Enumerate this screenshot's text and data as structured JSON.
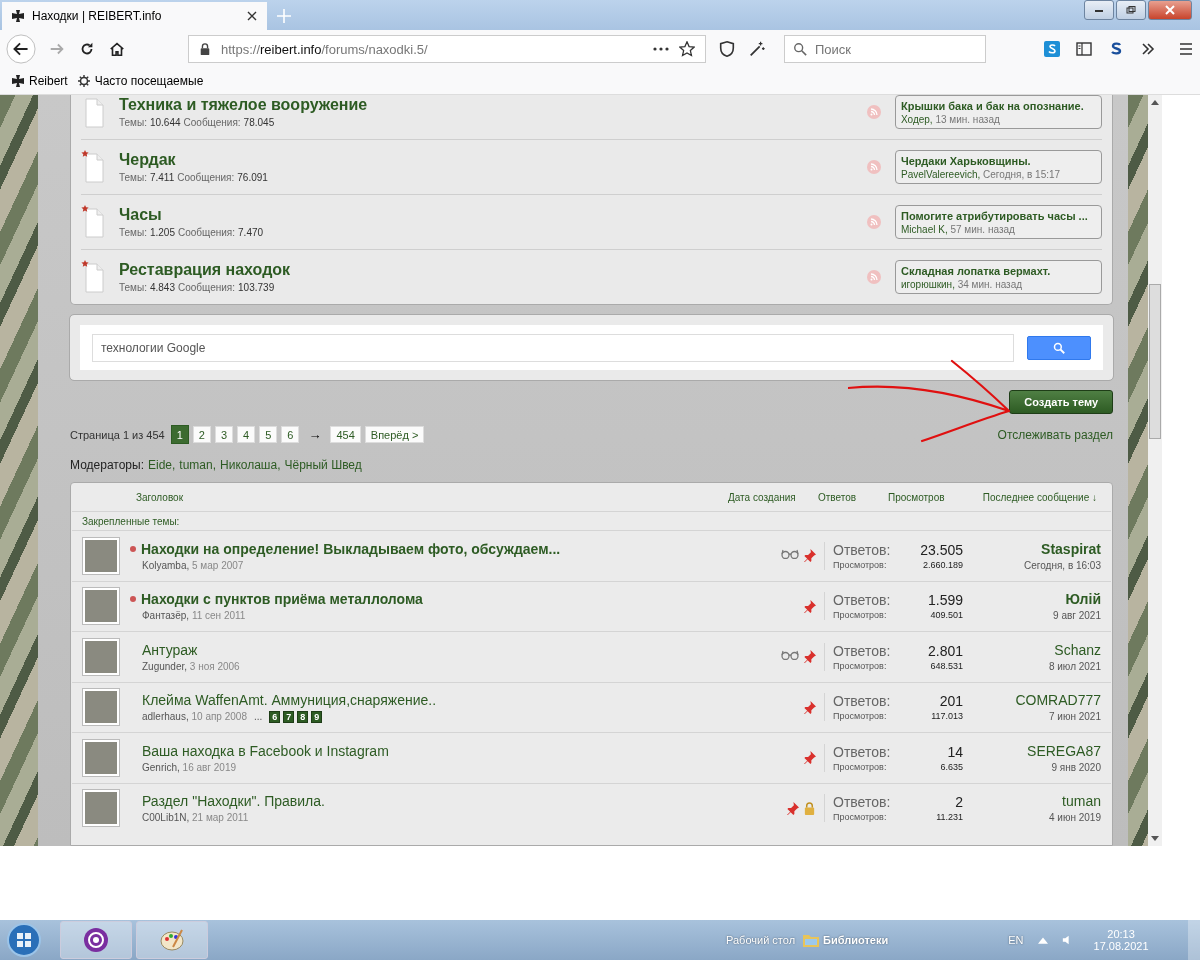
{
  "browser": {
    "tab_title": "Находки | REIBERT.info",
    "url": {
      "scheme": "https://",
      "host": "reibert.info",
      "path": "/forums/naxodki.5/"
    },
    "search_placeholder": "Поиск",
    "bookmarks": [
      "Reibert",
      "Часто посещаемые"
    ]
  },
  "forums": [
    {
      "title": "Техника и тяжелое вооружение",
      "new": false,
      "topics_label": "Темы:",
      "topics": "10.644",
      "messages_label": "Сообщения:",
      "messages": "78.045",
      "last_post": {
        "title": "Крышки бака и бак на опознание.",
        "author": "Ходер,",
        "time": "13 мин. назад"
      }
    },
    {
      "title": "Чердак",
      "new": true,
      "topics_label": "Темы:",
      "topics": "7.411",
      "messages_label": "Сообщения:",
      "messages": "76.091",
      "last_post": {
        "title": "Чердаки Харьковщины.",
        "author": "PavelValereevich,",
        "time": "Сегодня, в 15:17"
      }
    },
    {
      "title": "Часы",
      "new": true,
      "topics_label": "Темы:",
      "topics": "1.205",
      "messages_label": "Сообщения:",
      "messages": "7.470",
      "last_post": {
        "title": "Помогите атрибутировать часы ...",
        "author": "Michael K,",
        "time": "57 мин. назад"
      }
    },
    {
      "title": "Реставрация находок",
      "new": true,
      "topics_label": "Темы:",
      "topics": "4.843",
      "messages_label": "Сообщения:",
      "messages": "103.739",
      "last_post": {
        "title": "Складная лопатка вермахт.",
        "author": "игорюшкин,",
        "time": "34 мин. назад"
      }
    }
  ],
  "search": {
    "placeholder": "технологии Google"
  },
  "create_button": "Создать тему",
  "pagination": {
    "label": "Страница 1 из 454",
    "pages": [
      {
        "label": "1",
        "selected": true
      },
      {
        "label": "2",
        "selected": false
      },
      {
        "label": "3",
        "selected": false
      },
      {
        "label": "4",
        "selected": false
      },
      {
        "label": "5",
        "selected": false
      },
      {
        "label": "6",
        "selected": false
      }
    ],
    "arrow": "→",
    "last": "454",
    "next": "Вперёд >"
  },
  "watch_link": "Отслеживать раздел",
  "moderators": {
    "label": "Модераторы:",
    "names": [
      "Eide,",
      "tuman,",
      "Николаша,",
      "Чёрный Швед"
    ]
  },
  "table": {
    "columns": [
      "Заголовок",
      "Дата создания",
      "Ответов",
      "Просмотров",
      "Последнее сообщение ↓"
    ],
    "sticky_label": "Закрепленные темы:",
    "threads": [
      {
        "title": "Находки на определение! Выкладываем фото, обсуждаем...",
        "unread": true,
        "author": "Kolyamba,",
        "date": "5 мар 2007",
        "watched": true,
        "pinned": true,
        "locked": false,
        "replies_label": "Ответов:",
        "replies": "23.505",
        "views_label": "Просмотров:",
        "views": "2.660.189",
        "last_user": "Staspirat",
        "last_date": "Сегодня, в 16:03"
      },
      {
        "title": "Находки с пунктов приёма металлолома",
        "unread": true,
        "author": "Фантазёр,",
        "date": "11 сен 2011",
        "watched": false,
        "pinned": true,
        "locked": false,
        "replies_label": "Ответов:",
        "replies": "1.599",
        "views_label": "Просмотров:",
        "views": "409.501",
        "last_user": "Юлій",
        "last_date": "9 авг 2021"
      },
      {
        "title": "Антураж",
        "unread": false,
        "author": "Zugunder,",
        "date": "3 ноя 2006",
        "watched": true,
        "pinned": true,
        "locked": false,
        "replies_label": "Ответов:",
        "replies": "2.801",
        "views_label": "Просмотров:",
        "views": "648.531",
        "last_user": "Schanz",
        "last_date": "8 июл 2021"
      },
      {
        "title": "Клейма WaffenAmt. Аммуниция,снаряжение..",
        "unread": false,
        "author": "adlerhaus,",
        "date": "10 апр 2008",
        "pages_ellipsis": "...",
        "pages": [
          "6",
          "7",
          "8",
          "9"
        ],
        "watched": false,
        "pinned": true,
        "locked": false,
        "replies_label": "Ответов:",
        "replies": "201",
        "views_label": "Просмотров:",
        "views": "117.013",
        "last_user": "COMRAD777",
        "last_date": "7 июн 2021"
      },
      {
        "title": "Ваша находка в Facebook и Instagram",
        "unread": false,
        "author": "Genrich,",
        "date": "16 авг 2019",
        "watched": false,
        "pinned": true,
        "locked": false,
        "replies_label": "Ответов:",
        "replies": "14",
        "views_label": "Просмотров:",
        "views": "6.635",
        "last_user": "SEREGA87",
        "last_date": "9 янв 2020"
      },
      {
        "title": "Раздел \"Находки\". Правила.",
        "unread": false,
        "author": "C00Lib1N,",
        "date": "21 мар 2011",
        "watched": false,
        "pinned": true,
        "locked": true,
        "replies_label": "Ответов:",
        "replies": "2",
        "views_label": "Просмотров:",
        "views": "11.231",
        "last_user": "tuman",
        "last_date": "4 июн 2019"
      }
    ]
  },
  "taskbar": {
    "desktop": "Рабочий стол",
    "libraries": "Библиотеки",
    "language": "EN",
    "time": "20:13",
    "date": "17.08.2021"
  }
}
